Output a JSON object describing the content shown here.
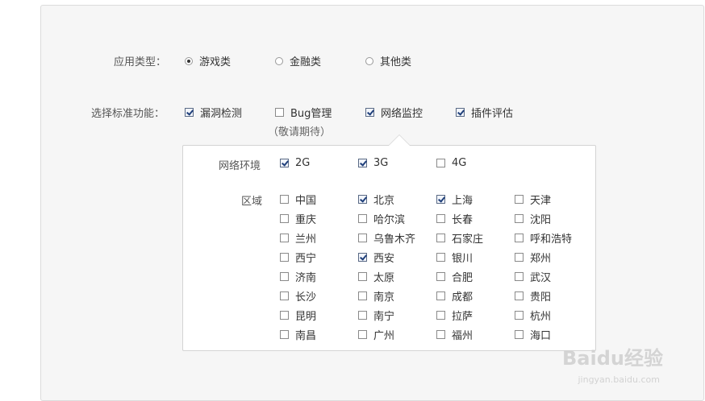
{
  "app_type": {
    "label": "应用类型：",
    "options": [
      {
        "label": "游戏类",
        "checked": true
      },
      {
        "label": "金融类",
        "checked": false
      },
      {
        "label": "其他类",
        "checked": false
      }
    ]
  },
  "features": {
    "label": "选择标准功能：",
    "options": [
      {
        "label": "漏洞检测",
        "checked": true
      },
      {
        "label": "Bug管理",
        "checked": false
      },
      {
        "label": "网络监控",
        "checked": true
      },
      {
        "label": "插件评估",
        "checked": true
      }
    ],
    "coming_soon": "（敬请期待）"
  },
  "network_popup": {
    "env_label": "网络环境",
    "env_options": [
      {
        "label": "2G",
        "checked": true
      },
      {
        "label": "3G",
        "checked": true
      },
      {
        "label": "4G",
        "checked": false
      }
    ],
    "region_label": "区域",
    "regions": [
      {
        "label": "中国",
        "checked": false
      },
      {
        "label": "北京",
        "checked": true
      },
      {
        "label": "上海",
        "checked": true
      },
      {
        "label": "天津",
        "checked": false
      },
      {
        "label": "重庆",
        "checked": false
      },
      {
        "label": "哈尔滨",
        "checked": false
      },
      {
        "label": "长春",
        "checked": false
      },
      {
        "label": "沈阳",
        "checked": false
      },
      {
        "label": "兰州",
        "checked": false
      },
      {
        "label": "乌鲁木齐",
        "checked": false
      },
      {
        "label": "石家庄",
        "checked": false
      },
      {
        "label": "呼和浩特",
        "checked": false
      },
      {
        "label": "西宁",
        "checked": false
      },
      {
        "label": "西安",
        "checked": true
      },
      {
        "label": "银川",
        "checked": false
      },
      {
        "label": "郑州",
        "checked": false
      },
      {
        "label": "济南",
        "checked": false
      },
      {
        "label": "太原",
        "checked": false
      },
      {
        "label": "合肥",
        "checked": false
      },
      {
        "label": "武汉",
        "checked": false
      },
      {
        "label": "长沙",
        "checked": false
      },
      {
        "label": "南京",
        "checked": false
      },
      {
        "label": "成都",
        "checked": false
      },
      {
        "label": "贵阳",
        "checked": false
      },
      {
        "label": "昆明",
        "checked": false
      },
      {
        "label": "南宁",
        "checked": false
      },
      {
        "label": "拉萨",
        "checked": false
      },
      {
        "label": "杭州",
        "checked": false
      },
      {
        "label": "南昌",
        "checked": false
      },
      {
        "label": "广州",
        "checked": false
      },
      {
        "label": "福州",
        "checked": false
      },
      {
        "label": "海口",
        "checked": false
      }
    ]
  },
  "watermark": {
    "brand": "Baidu经验",
    "url": "jingyan.baidu.com"
  }
}
